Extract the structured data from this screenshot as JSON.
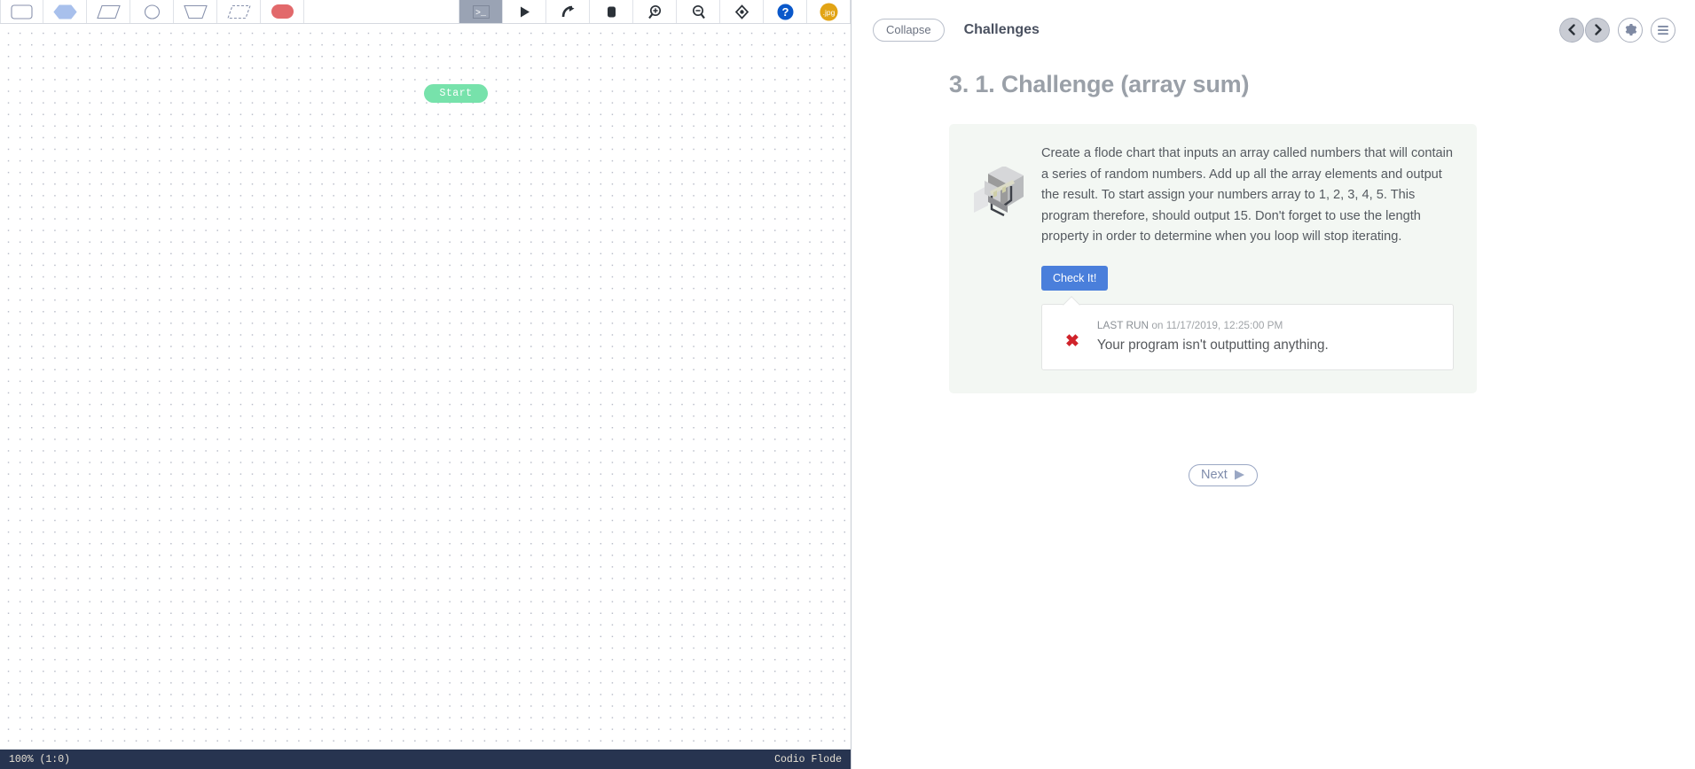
{
  "editor": {
    "palette": [
      {
        "name": "process-shape-tool",
        "icon": "rounded-rectangle-icon",
        "label": "Process"
      },
      {
        "name": "decision-shape-tool",
        "icon": "hexagon-icon",
        "label": "Decision"
      },
      {
        "name": "input-shape-tool",
        "icon": "parallelogram-icon",
        "label": "Input"
      },
      {
        "name": "connector-shape-tool",
        "icon": "ellipse-icon",
        "label": "Connector"
      },
      {
        "name": "output-shape-tool",
        "icon": "trapezoid-icon",
        "label": "Output"
      },
      {
        "name": "comment-shape-tool",
        "icon": "dashed-parallelogram-icon",
        "label": "Comment"
      },
      {
        "name": "end-shape-tool",
        "icon": "red-rounded-rectangle-icon",
        "label": "End"
      }
    ],
    "actions": [
      {
        "name": "console-button",
        "icon": "terminal-icon",
        "label": "Console"
      },
      {
        "name": "run-button",
        "icon": "play-icon",
        "label": "Run"
      },
      {
        "name": "step-button",
        "icon": "curved-arrow-icon",
        "label": "Step"
      },
      {
        "name": "stop-button",
        "icon": "stop-square-icon",
        "label": "Stop"
      },
      {
        "name": "zoom-in-button",
        "icon": "magnifier-plus-icon",
        "label": "Zoom in"
      },
      {
        "name": "zoom-out-button",
        "icon": "magnifier-minus-icon",
        "label": "Zoom out"
      },
      {
        "name": "zoom-reset-button",
        "icon": "diamond-target-icon",
        "label": "Reset zoom"
      },
      {
        "name": "help-button",
        "icon": "question-mark-icon",
        "label": "Help"
      },
      {
        "name": "export-jpg-button",
        "icon": "jpg-icon",
        "label": ".jpg"
      }
    ],
    "nodes": [
      {
        "name": "start-node",
        "label": "Start",
        "color": "#77e2ab"
      }
    ],
    "statusbar": {
      "zoom": "100% (1:0)",
      "brand": "Codio Flode"
    }
  },
  "panel": {
    "collapse_label": "Collapse",
    "title": "Challenges",
    "header_actions": [
      {
        "name": "prev-challenge-button",
        "icon": "chevron-left-icon",
        "glyph": "❮"
      },
      {
        "name": "next-challenge-button",
        "icon": "chevron-right-icon",
        "glyph": "❯"
      },
      {
        "name": "settings-button",
        "icon": "gear-icon"
      },
      {
        "name": "menu-button",
        "icon": "hamburger-menu-icon"
      }
    ],
    "challenge": {
      "title": "3. 1. Challenge (array sum)",
      "illustration": "isometric-room-icon",
      "description": "Create a flode chart that inputs an array called numbers that will contain a series of random numbers. Add up all the array elements and output the result. To start assign your numbers array to 1, 2, 3, 4, 5. This program therefore, should output 15. Don't forget to use the length property in order to determine when you loop will stop iterating.",
      "check_label": "Check It!",
      "check_color": "#4a7fdb",
      "result": {
        "status": "fail",
        "status_icon": "red-x-icon",
        "status_color": "#d0232b",
        "last_run_label": "LAST RUN",
        "last_run_on": "on",
        "last_run_time": "11/17/2019, 12:25:00 PM",
        "message": "Your program isn't outputting anything."
      }
    },
    "next_label": "Next"
  }
}
